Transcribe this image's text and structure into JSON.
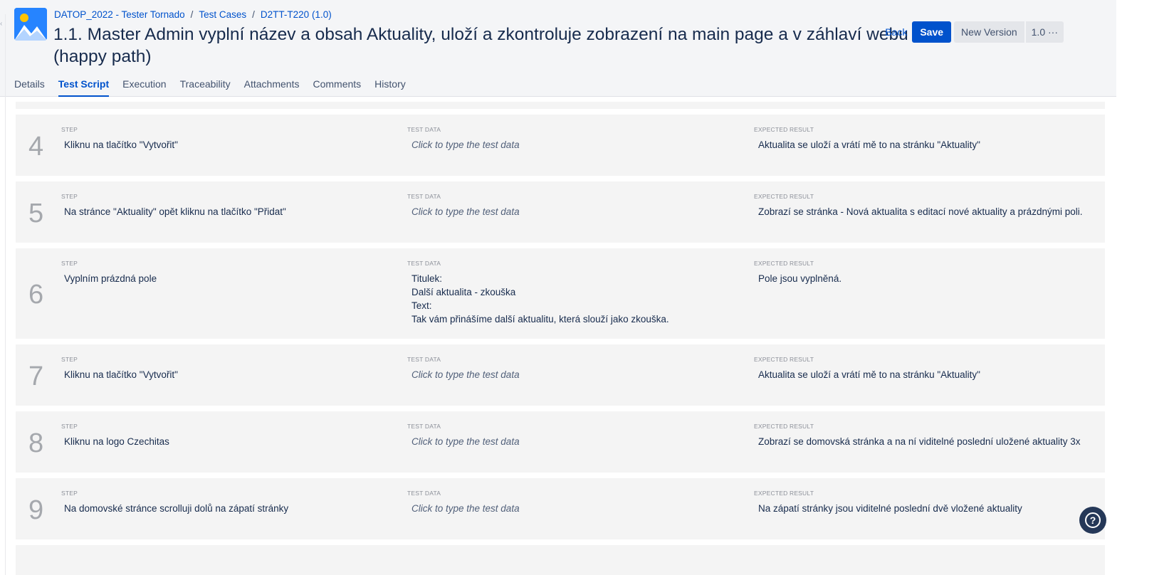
{
  "breadcrumb": {
    "project": "DATOP_2022 - Tester Tornado",
    "section": "Test Cases",
    "key": "D2TT-T220 (1.0)"
  },
  "title": "1.1. Master Admin vyplní název a obsah Aktuality, uloží a zkontroluje zobrazení na main page a v záhlaví webu (happy path)",
  "actions": {
    "back": "Back",
    "save": "Save",
    "new_version": "New Version",
    "version": "1.0",
    "more": "···"
  },
  "tabs": [
    {
      "label": "Details"
    },
    {
      "label": "Test Script"
    },
    {
      "label": "Execution"
    },
    {
      "label": "Traceability"
    },
    {
      "label": "Attachments"
    },
    {
      "label": "Comments"
    },
    {
      "label": "History"
    }
  ],
  "column_labels": {
    "step": "STEP",
    "test_data": "TEST DATA",
    "expected": "EXPECTED RESULT"
  },
  "steps": [
    {
      "number": "4",
      "step": "Kliknu na tlačítko \"Vytvořit\"",
      "test_data": "Click to type the test data",
      "expected": "Aktualita se uloží a vrátí mě to na stránku \"Aktuality\""
    },
    {
      "number": "5",
      "step": "Na stránce \"Aktuality\" opět kliknu na tlačítko \"Přidat\"",
      "test_data": "Click to type the test data",
      "expected": "Zobrazí se stránka - Nová aktualita s editací nové aktuality a prázdnými poli."
    },
    {
      "number": "6",
      "step": "Vyplním prázdná pole",
      "test_data_lines": [
        "Titulek:",
        "Další aktualita - zkouška",
        "Text:",
        "Tak vám přinášíme další aktualitu, která slouží jako zkouška."
      ],
      "expected": "Pole jsou vyplněná."
    },
    {
      "number": "7",
      "step": "Kliknu na tlačítko \"Vytvořit\"",
      "test_data": "Click to type the test data",
      "expected": "Aktualita se uloží a vrátí mě to na stránku \"Aktuality\""
    },
    {
      "number": "8",
      "step": "Kliknu na logo Czechitas",
      "test_data": "Click to type the test data",
      "expected": "Zobrazí se domovská stránka a na ní viditelné poslední uložené aktuality 3x"
    },
    {
      "number": "9",
      "step": "Na domovské stránce scrolluji dolů na zápatí stránky",
      "test_data": "Click to type the test data",
      "expected": "Na zápatí stránky jsou viditelné poslední dvě vložené aktuality"
    }
  ],
  "help": "?",
  "colors": {
    "accent": "#0052cc",
    "card_bg": "#f4f4f4",
    "header_bg": "#f4f5f7",
    "help_bg": "#253858"
  }
}
